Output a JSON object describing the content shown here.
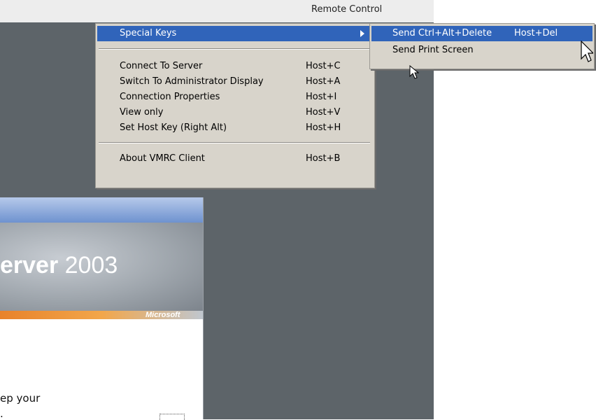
{
  "window": {
    "top_text": "Remote Control"
  },
  "menu": {
    "items": [
      {
        "label": "Special Keys",
        "shortcut": ""
      },
      {
        "label": "Connect To Server",
        "shortcut": "Host+C"
      },
      {
        "label": "Switch To Administrator Display",
        "shortcut": "Host+A"
      },
      {
        "label": "Connection Properties",
        "shortcut": "Host+I"
      },
      {
        "label": "View only",
        "shortcut": "Host+V"
      },
      {
        "label": "Set Host Key (Right Alt)",
        "shortcut": "Host+H"
      },
      {
        "label": "About VMRC Client",
        "shortcut": "Host+B"
      }
    ]
  },
  "submenu": {
    "items": [
      {
        "label": "Send Ctrl+Alt+Delete",
        "shortcut": "Host+Del"
      },
      {
        "label": "Send Print Screen",
        "shortcut": ""
      }
    ]
  },
  "splash": {
    "title_bold": "erver",
    "title_year": " 2003",
    "brand": "Microsoft",
    "body_text": "ep your",
    "body_text2": "."
  },
  "colors": {
    "desktop": "#5d6469",
    "menu_bg": "#d8d4cb",
    "highlight": "#3064ba",
    "accent_orange": "#e8822a"
  },
  "icons": [
    "submenu-arrow-icon",
    "mouse-pointer-icon"
  ]
}
